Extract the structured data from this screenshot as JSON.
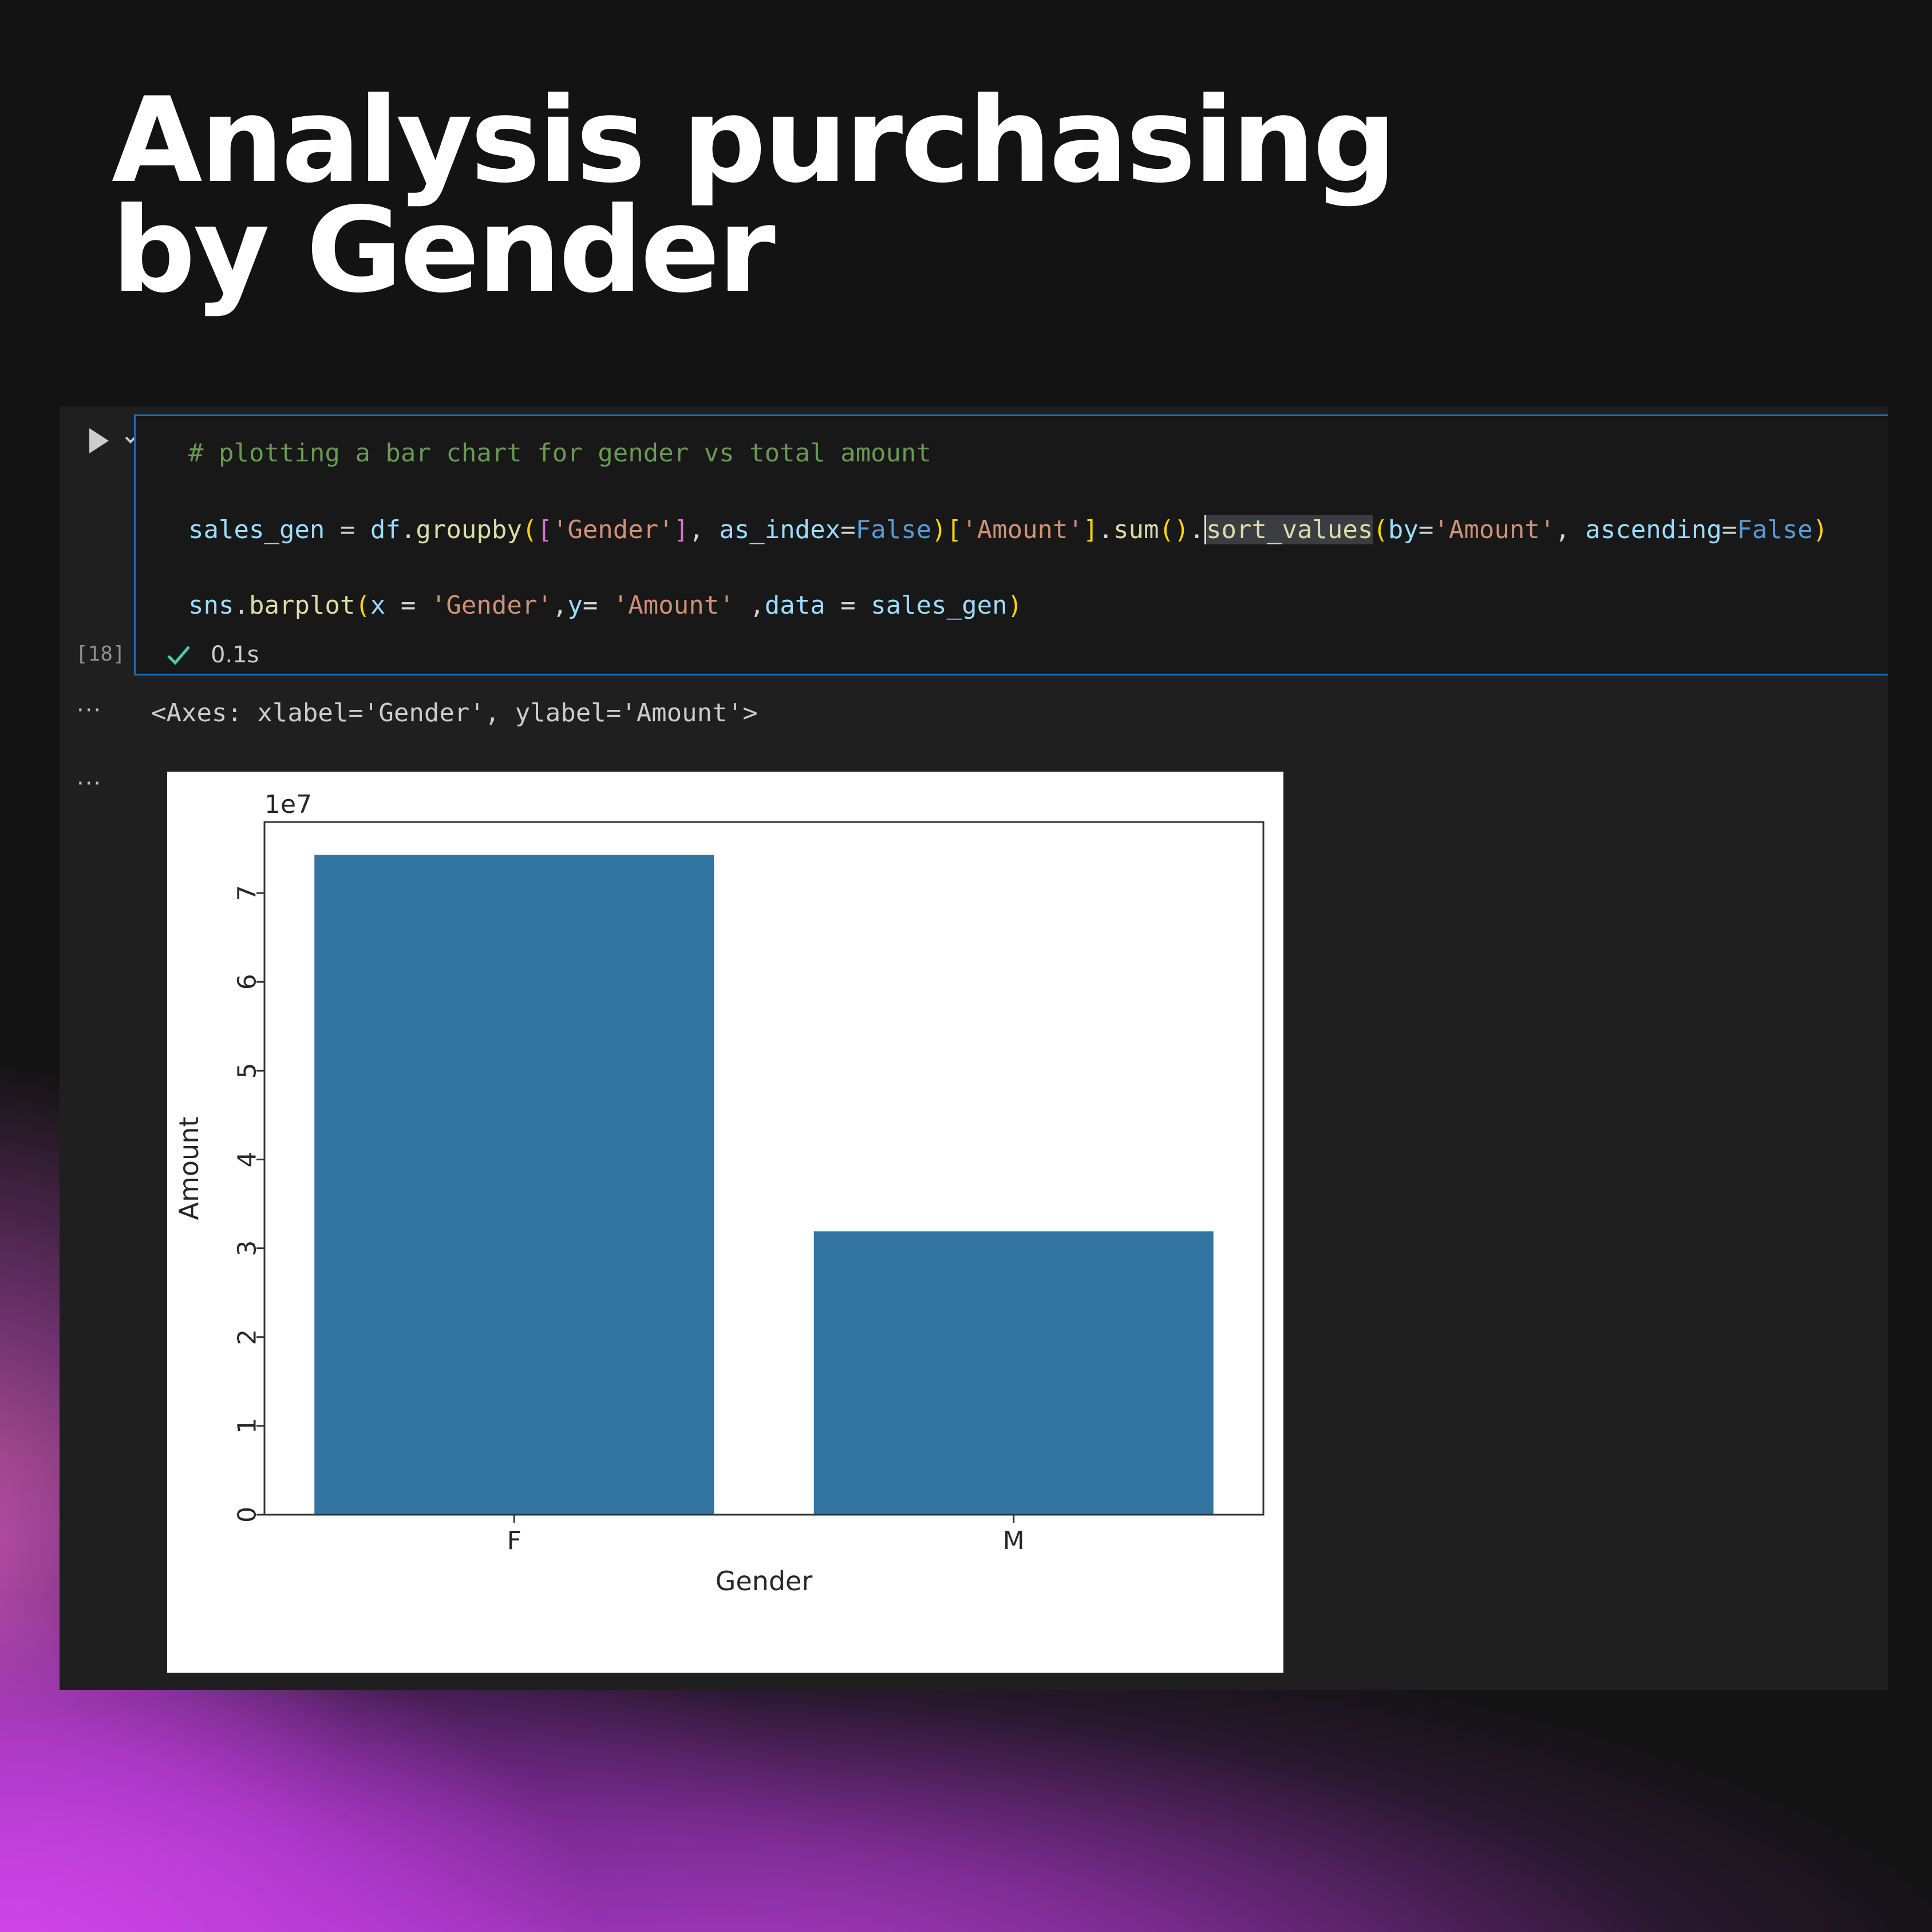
{
  "title": {
    "line1": "Analysis purchasing",
    "line2": "by Gender"
  },
  "cell": {
    "execution_count": "[18]",
    "status_time": "0.1s",
    "code": {
      "comment": "# plotting a bar chart for gender vs total amount",
      "l2": [
        "sales_gen",
        " = ",
        "df",
        ".",
        "groupby",
        "(",
        "[",
        "'Gender'",
        "]",
        ", ",
        "as_index",
        "=",
        "False",
        ")",
        "[",
        "'Amount'",
        "]",
        ".",
        "sum",
        "()",
        ".",
        "sort_values",
        "(",
        "by",
        "=",
        "'Amount'",
        ", ",
        "ascending",
        "=",
        "False",
        ")"
      ],
      "l3": [
        "sns",
        ".",
        "barplot",
        "(",
        "x",
        " = ",
        "'Gender'",
        ",",
        "y",
        "= ",
        "'Amount'",
        " ,",
        "data",
        " = ",
        "sales_gen",
        ")"
      ]
    }
  },
  "output": {
    "ellipsis": "···",
    "axes_repr": "<Axes: xlabel='Gender', ylabel='Amount'>"
  },
  "chart_data": {
    "type": "bar",
    "categories": [
      "F",
      "M"
    ],
    "values": [
      74300000,
      31900000
    ],
    "xlabel": "Gender",
    "ylabel": "Amount",
    "offset_text": "1e7",
    "yticks": [
      0,
      1,
      2,
      3,
      4,
      5,
      6,
      7
    ],
    "ylim": [
      0,
      7.8
    ],
    "scale": 10000000,
    "bar_color": "#3274a1"
  },
  "colors": {
    "background": "#131313",
    "cell_border": "#1f6fb0",
    "accent_glow": "#cf48ee",
    "check": "#4ec9b0"
  },
  "icons": {
    "run": "play-icon",
    "collapse": "chevron-down-icon",
    "success": "check-icon"
  }
}
